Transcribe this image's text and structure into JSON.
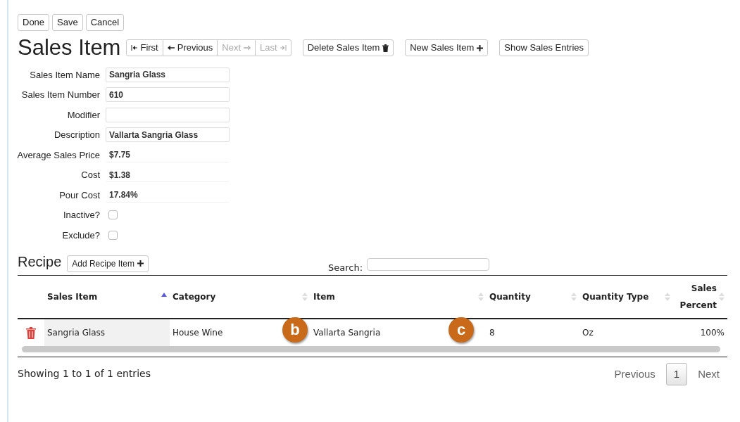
{
  "top_buttons": [
    "Done",
    "Save",
    "Cancel"
  ],
  "title": "Sales Item",
  "nav_buttons": [
    {
      "label": "First",
      "disabled": false
    },
    {
      "label": "Previous",
      "disabled": false
    },
    {
      "label": "Next",
      "disabled": true
    },
    {
      "label": "Last",
      "disabled": true
    }
  ],
  "action_buttons": [
    {
      "label": "Delete Sales Item"
    },
    {
      "label": "New Sales Item"
    },
    {
      "label": "Show Sales Entries"
    }
  ],
  "fields": [
    {
      "label": "Sales Item Name",
      "kind": "text",
      "value": "Sangria Glass",
      "readonly": false
    },
    {
      "label": "Sales Item Number",
      "kind": "text",
      "value": "610",
      "readonly": false
    },
    {
      "label": "Modifier",
      "kind": "text",
      "readonly": false
    },
    {
      "label": "Description",
      "kind": "text",
      "value": "Vallarta Sangria Glass",
      "readonly": false
    },
    {
      "label": "Average Sales Price",
      "kind": "text",
      "value": "$7.75",
      "readonly": true
    },
    {
      "label": "Cost",
      "kind": "text",
      "value": "$1.38",
      "readonly": true
    },
    {
      "label": "Pour Cost",
      "kind": "text",
      "value": "17.84%",
      "readonly": true
    },
    {
      "label": "Inactive?",
      "kind": "checkbox",
      "checked": false
    },
    {
      "label": "Exclude?",
      "kind": "checkbox",
      "checked": false
    }
  ],
  "recipe": {
    "title": "Recipe",
    "add_button": "Add Recipe Item",
    "search_label": "Search:",
    "columns": [
      {
        "label": "Sales Item",
        "sorted": true
      },
      {
        "label": "Category",
        "sorted": false
      },
      {
        "label": "Item",
        "sorted": false
      },
      {
        "label": "Quantity",
        "sorted": false
      },
      {
        "label": "Quantity Type",
        "sorted": false
      },
      {
        "label": "Sales Percent",
        "sorted": false
      }
    ],
    "rows": [
      {
        "cells": [
          "Sangria Glass",
          "House Wine",
          "Vallarta Sangria",
          "8",
          "Oz",
          "100%"
        ]
      }
    ],
    "info": "Showing 1 to 1 of 1 entries",
    "pagination": [
      {
        "label": "Previous",
        "selected": false
      },
      {
        "label": "1",
        "selected": true
      },
      {
        "label": "Next",
        "selected": false
      }
    ]
  },
  "callouts": [
    {
      "label": "b"
    },
    {
      "label": "c"
    }
  ]
}
